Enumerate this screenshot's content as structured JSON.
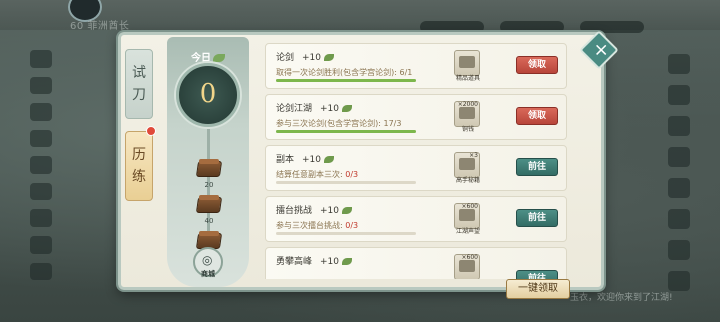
{
  "background": {
    "player_name": "60 菲洲酋长",
    "chat_preview": "玉衣，欢迎你来到了江湖!"
  },
  "tabs": [
    {
      "label_1": "试",
      "label_2": "刀",
      "active": false
    },
    {
      "label_1": "历",
      "label_2": "练",
      "active": true,
      "has_notification": true
    }
  ],
  "progress": {
    "today_label": "今日",
    "today_value": "0",
    "milestones": [
      "20",
      "40",
      "60"
    ],
    "shop_label": "商城"
  },
  "tasks": [
    {
      "title": "论剑",
      "points": "+10",
      "description": "取得一次论剑胜利(包含学宫论剑): ",
      "count": "6/1",
      "count_red": false,
      "progress": 1.0,
      "reward_qty": "",
      "reward_label": "精品道具",
      "button": "领取",
      "button_type": "claim"
    },
    {
      "title": "论剑江湖",
      "points": "+10",
      "description": "参与三次论剑(包含学宫论剑): ",
      "count": "17/3",
      "count_red": false,
      "progress": 1.0,
      "reward_qty": "×2000",
      "reward_label": "铜钱",
      "button": "领取",
      "button_type": "claim"
    },
    {
      "title": "副本",
      "points": "+10",
      "description": "结算任意副本三次: ",
      "count": "0/3",
      "count_red": true,
      "progress": 0.0,
      "reward_qty": "×3",
      "reward_label": "高手秘籍",
      "button": "前往",
      "button_type": "go"
    },
    {
      "title": "擂台挑战",
      "points": "+10",
      "description": "参与三次擂台挑战: ",
      "count": "0/3",
      "count_red": true,
      "progress": 0.0,
      "reward_qty": "×600",
      "reward_label": "江湖声望",
      "button": "前往",
      "button_type": "go"
    },
    {
      "title": "勇攀高峰",
      "points": "+10",
      "description": "",
      "count": "",
      "count_red": false,
      "progress": 0.0,
      "reward_qty": "×600",
      "reward_label": "",
      "button": "前往",
      "button_type": "go"
    }
  ],
  "actions": {
    "claim_all": "一键领取",
    "close": "×"
  }
}
